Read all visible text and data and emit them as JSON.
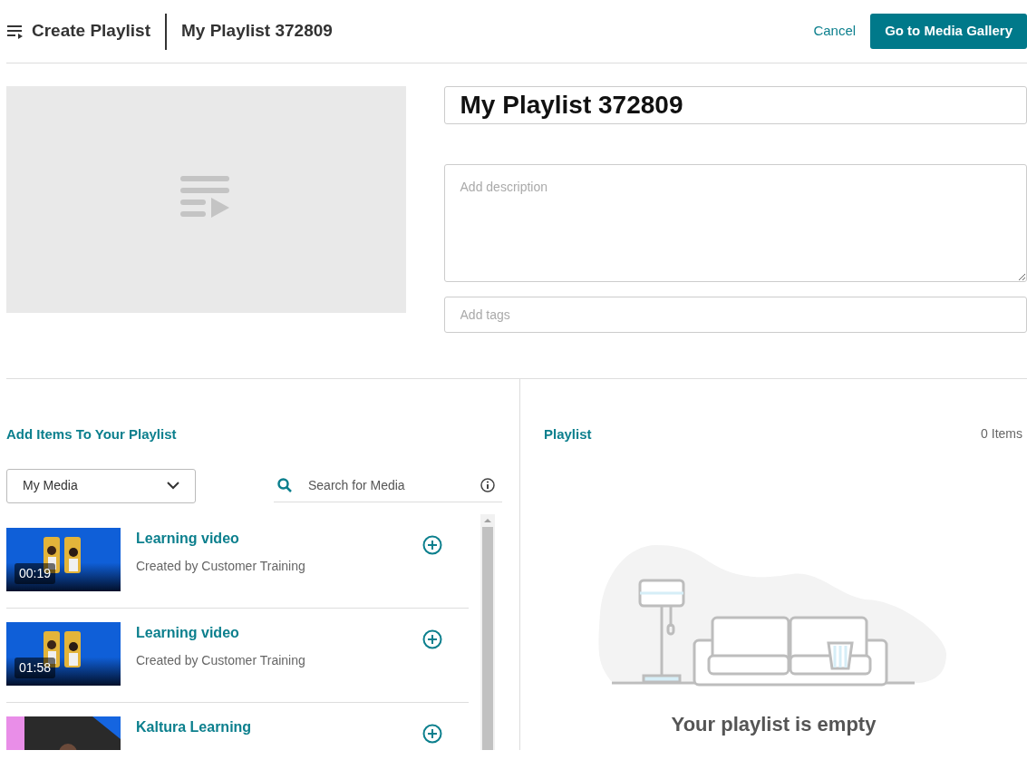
{
  "header": {
    "menu_label": "Create Playlist",
    "playlist_name": "My Playlist 372809",
    "cancel": "Cancel",
    "primary_button": "Go to Media Gallery"
  },
  "details": {
    "title_value": "My Playlist 372809",
    "description": {
      "placeholder": "Add description"
    },
    "tags": {
      "placeholder": "Add tags"
    }
  },
  "add_items": {
    "heading": "Add Items To Your Playlist",
    "source_select": "My Media",
    "search": {
      "placeholder": "Search for Media"
    },
    "media": [
      {
        "title": "Learning video",
        "owner": "Created by Customer Training",
        "duration": "00:19",
        "kind": "picture"
      },
      {
        "title": "Learning video",
        "owner": "Created by Customer Training",
        "duration": "01:58",
        "kind": "picture"
      },
      {
        "title": "Kaltura Learning",
        "kind": "picture"
      }
    ]
  },
  "playlist": {
    "heading": "Playlist",
    "count": "0 Items",
    "empty_message": "Your playlist is empty"
  }
}
